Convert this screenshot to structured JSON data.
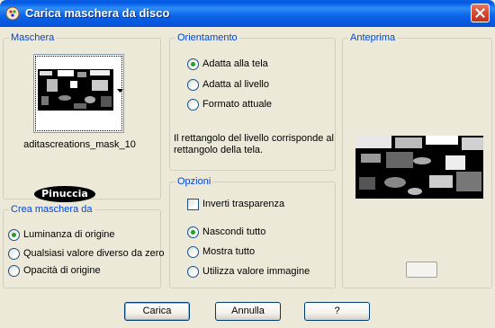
{
  "window": {
    "title": "Carica maschera da disco"
  },
  "mask_group": {
    "legend": "Maschera",
    "mask_name": "aditascreations_mask_10",
    "watermark": "Pinuccia"
  },
  "create_group": {
    "legend": "Crea maschera da",
    "options": [
      {
        "label": "Luminanza di origine",
        "checked": true
      },
      {
        "label": "Qualsiasi valore diverso da zero",
        "checked": false
      },
      {
        "label": "Opacità di origine",
        "checked": false
      }
    ]
  },
  "orientation_group": {
    "legend": "Orientamento",
    "options": [
      {
        "label": "Adatta alla tela",
        "checked": true
      },
      {
        "label": "Adatta al livello",
        "checked": false
      },
      {
        "label": "Formato attuale",
        "checked": false
      }
    ],
    "info": "Il rettangolo del livello corrisponde al rettangolo della tela."
  },
  "options_group": {
    "legend": "Opzioni",
    "invert_label": "Inverti trasparenza",
    "invert_checked": false,
    "options": [
      {
        "label": "Nascondi tutto",
        "checked": true
      },
      {
        "label": "Mostra tutto",
        "checked": false
      },
      {
        "label": "Utilizza valore immagine",
        "checked": false
      }
    ]
  },
  "preview_group": {
    "legend": "Anteprima"
  },
  "buttons": {
    "load": "Carica",
    "cancel": "Annulla",
    "help": "?"
  },
  "colors": {
    "titlebar": "#0a64e8",
    "legend_text": "#0046d5",
    "dialog_bg": "#ece9d8",
    "radio_checked": "#21a121"
  },
  "icons": {
    "app": "psp-app-icon",
    "close": "close-icon",
    "dropdown": "chevron-down-icon"
  }
}
